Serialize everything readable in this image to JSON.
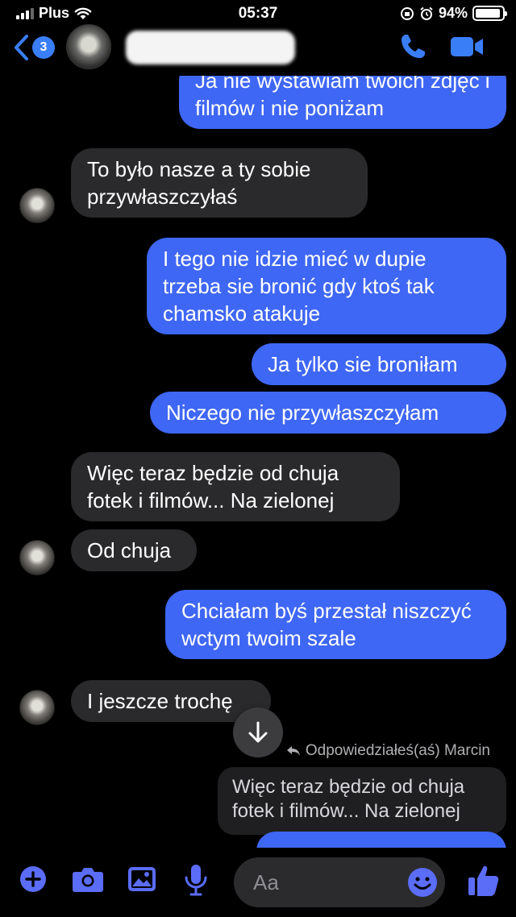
{
  "status_bar": {
    "carrier": "Plus",
    "time": "05:37",
    "battery": "94%",
    "battery_level": 0.94
  },
  "header": {
    "unread_count": "3"
  },
  "messages": [
    {
      "side": "out",
      "text": "Ja nie wystawiam twoich zdjęć i filmów i nie poniżam"
    },
    {
      "side": "in",
      "text": "To było nasze a ty sobie przywłaszczyłaś"
    },
    {
      "side": "out",
      "text": "I tego nie idzie mieć w dupie trzeba sie bronić gdy ktoś tak chamsko atakuje"
    },
    {
      "side": "out",
      "text": "Ja tylko sie broniłam"
    },
    {
      "side": "out",
      "text": "Niczego nie przywłaszczyłam"
    },
    {
      "side": "in",
      "text": "Więc teraz będzie od chuja fotek i filmów... Na zielonej"
    },
    {
      "side": "in",
      "text": "Od chuja"
    },
    {
      "side": "out",
      "text": "Chciałam byś przestał niszczyć wctym twoim szale"
    },
    {
      "side": "in",
      "text": "I jeszcze trochę"
    }
  ],
  "reply": {
    "label": "Odpowiedziałeś(aś) Marcin",
    "quoted_text": "Więc teraz będzie od chuja fotek i filmów... Na zielonej"
  },
  "composer": {
    "placeholder": "Aa"
  },
  "colors": {
    "outgoing_bubble": "#3f67f5",
    "incoming_bubble": "#2a2a2c",
    "accent": "#3a7ef7",
    "icon_blue": "#5b6cf7"
  },
  "icons": [
    "back-chevron-icon",
    "phone-icon",
    "video-camera-icon",
    "scroll-down-arrow-icon",
    "reply-arrow-icon",
    "plus-icon",
    "camera-icon",
    "gallery-icon",
    "microphone-icon",
    "emoji-icon",
    "thumbs-up-icon"
  ]
}
